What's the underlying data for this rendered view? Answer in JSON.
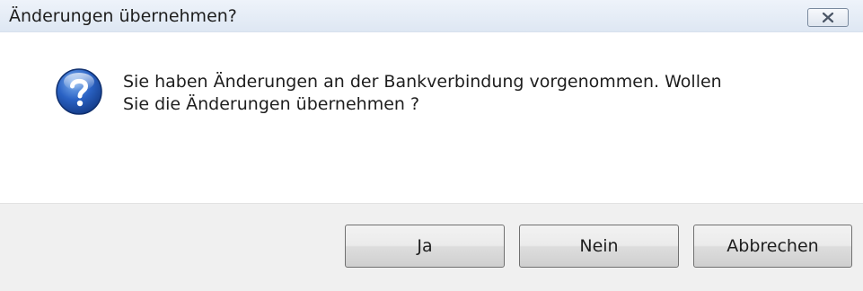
{
  "dialog": {
    "title": "Änderungen übernehmen?",
    "close_icon": "close-icon",
    "message_icon": "question-icon",
    "message_lines": [
      "Sie haben Änderungen an der Bankverbindung vorgenommen. Wollen",
      "Sie die Änderungen übernehmen ?"
    ]
  },
  "buttons": {
    "yes_label": "Ja",
    "no_label": "Nein",
    "cancel_label": "Abbrechen"
  },
  "colors": {
    "titlebar": "#dee7f3",
    "footer": "#f0f0f0",
    "icon_blue": "#1f4fa8"
  }
}
